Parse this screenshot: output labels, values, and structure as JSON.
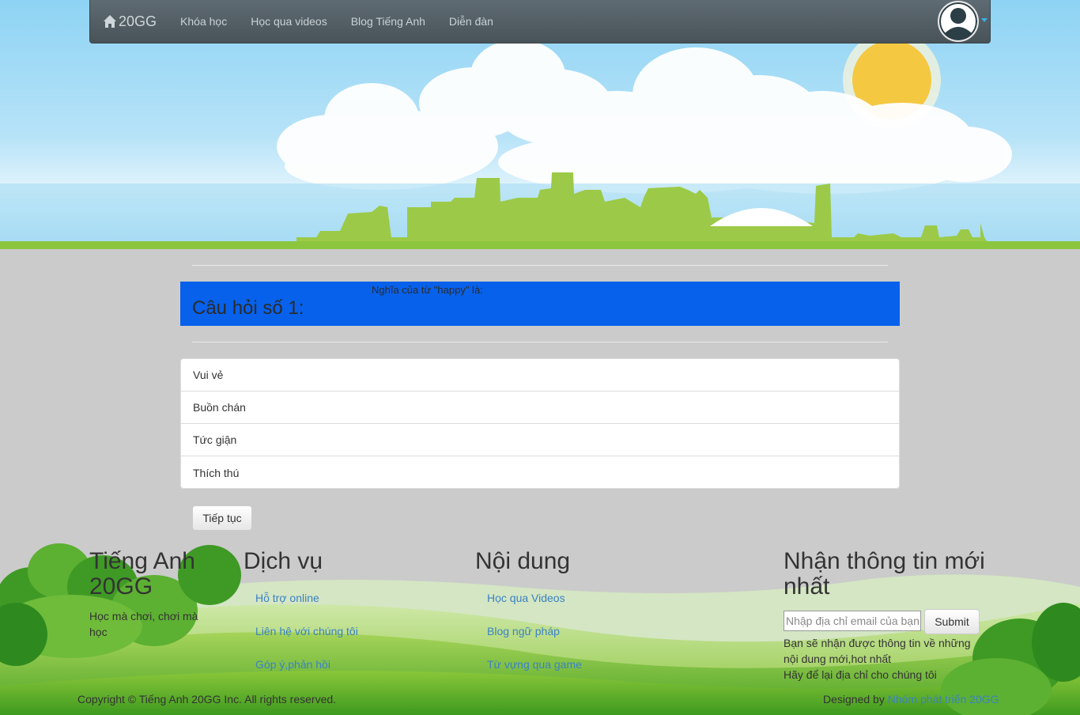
{
  "nav": {
    "brand": "20GG",
    "items": [
      {
        "label": "Khóa học"
      },
      {
        "label": "Học qua videos"
      },
      {
        "label": "Blog Tiếng Anh"
      },
      {
        "label": "Diễn đàn"
      }
    ]
  },
  "quiz": {
    "title": "Câu hỏi số 1:",
    "question": "Nghĩa của từ \"happy\" là:",
    "answers": [
      "Vui vẻ",
      "Buồn chán",
      "Tức giận",
      "Thích thú"
    ],
    "next_label": "Tiếp tục"
  },
  "footer": {
    "about": {
      "title": "Tiếng Anh 20GG",
      "text": "Học mà chơi, chơi mà học"
    },
    "services": {
      "title": "Dịch vụ",
      "links": [
        "Hỗ trợ online",
        "Liên hệ với chúng tôi",
        "Góp ý,phản hồi"
      ]
    },
    "content": {
      "title": "Nội dung",
      "links": [
        "Học qua Videos",
        "Blog ngữ pháp",
        "Từ vựng qua game"
      ]
    },
    "newsletter": {
      "title": "Nhận thông tin mới nhất",
      "placeholder": "Nhập địa chỉ email của bạn",
      "submit": "Submit",
      "text1": "Bạn sẽ nhận được thông tin về những nội dung mới,hot nhất",
      "text2": "Hãy để lại địa chỉ cho chúng tôi"
    },
    "copyright": "Copyright © Tiếng Anh 20GG Inc. All rights reserved.",
    "designed_prefix": "Designed by ",
    "designed_link": "Nhóm phát triển 20GG"
  },
  "colors": {
    "question_bg": "#0761eb",
    "link": "#3b82c4",
    "grass": "#8cc63f",
    "sun": "#f5c842"
  }
}
